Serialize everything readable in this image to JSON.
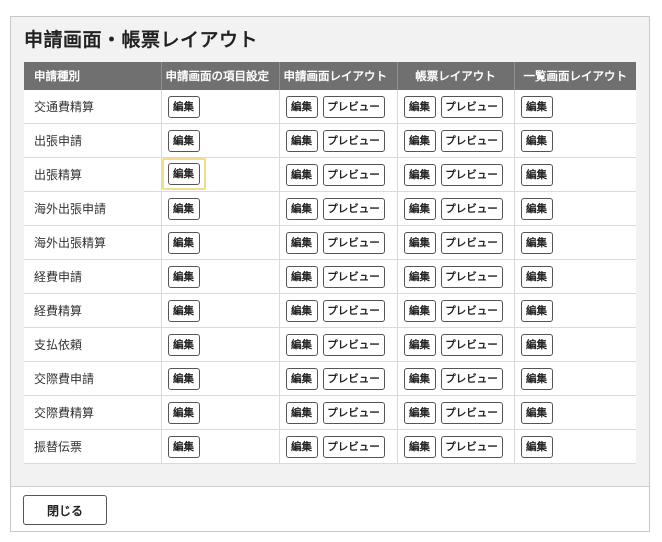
{
  "dialog": {
    "title": "申請画面・帳票レイアウト",
    "close_label": "閉じる"
  },
  "table": {
    "headers": [
      "申請種別",
      "申請画面の項目設定",
      "申請画面レイアウト",
      "帳票レイアウト",
      "一覧画面レイアウト"
    ],
    "edit_label": "編集",
    "preview_label": "プレビュー",
    "rows": [
      {
        "type": "交通費精算"
      },
      {
        "type": "出張申請"
      },
      {
        "type": "出張精算"
      },
      {
        "type": "海外出張申請"
      },
      {
        "type": "海外出張精算"
      },
      {
        "type": "経費申請"
      },
      {
        "type": "経費精算"
      },
      {
        "type": "支払依頼"
      },
      {
        "type": "交際費申請"
      },
      {
        "type": "交際費精算"
      },
      {
        "type": "振替伝票"
      }
    ],
    "focused_row": 2
  },
  "colors": {
    "header_bg": "#707070",
    "focus_ring": "#f3dc8f",
    "dialog_bg": "#f2f2f2"
  }
}
